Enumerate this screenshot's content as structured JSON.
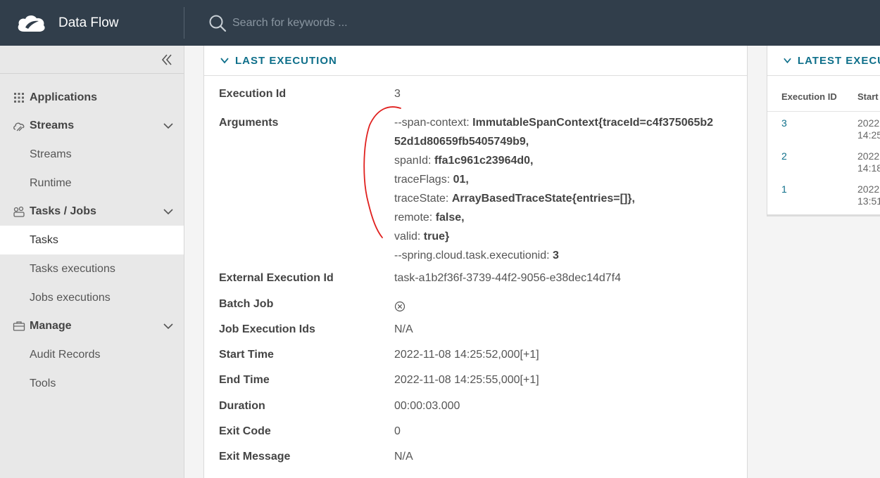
{
  "header": {
    "title": "Data Flow",
    "search_placeholder": "Search for keywords ..."
  },
  "sidebar": {
    "groups": [
      {
        "label": "Applications",
        "icon": "grid-icon"
      },
      {
        "label": "Streams",
        "icon": "streams-icon",
        "items": [
          "Streams",
          "Runtime"
        ]
      },
      {
        "label": "Tasks / Jobs",
        "icon": "tasks-icon",
        "items": [
          "Tasks",
          "Tasks executions",
          "Jobs executions"
        ]
      },
      {
        "label": "Manage",
        "icon": "briefcase-icon",
        "items": [
          "Audit Records",
          "Tools"
        ]
      }
    ],
    "active_item": "Tasks"
  },
  "last_execution": {
    "title": "LAST EXECUTION",
    "execution_id_label": "Execution Id",
    "execution_id": "3",
    "arguments_label": "Arguments",
    "arguments": [
      {
        "key": "--span-context: ",
        "value": "ImmutableSpanContext{traceId=c4f375065b2"
      },
      {
        "key": "",
        "value": "52d1d80659fb5405749b9,"
      },
      {
        "key": "spanId: ",
        "value": "ffa1c961c23964d0,"
      },
      {
        "key": "traceFlags: ",
        "value": "01,"
      },
      {
        "key": "traceState: ",
        "value": "ArrayBasedTraceState{entries=[]},"
      },
      {
        "key": "remote: ",
        "value": "false,"
      },
      {
        "key": "valid: ",
        "value": "true}"
      },
      {
        "key": "--spring.cloud.task.executionid: ",
        "value": "3"
      }
    ],
    "external_execution_id_label": "External Execution Id",
    "external_execution_id": "task-a1b2f36f-3739-44f2-9056-e38dec14d7f4",
    "batch_job_label": "Batch Job",
    "job_execution_ids_label": "Job Execution Ids",
    "job_execution_ids": "N/A",
    "start_time_label": "Start Time",
    "start_time": "2022-11-08 14:25:52,000[+1]",
    "end_time_label": "End Time",
    "end_time": "2022-11-08 14:25:55,000[+1]",
    "duration_label": "Duration",
    "duration": "00:00:03.000",
    "exit_code_label": "Exit Code",
    "exit_code": "0",
    "exit_message_label": "Exit Message",
    "exit_message": "N/A"
  },
  "latest_executions": {
    "title": "LATEST EXECU",
    "col_id": "Execution ID",
    "col_start": "Start",
    "rows": [
      {
        "id": "3",
        "start_1": "2022",
        "start_2": "14:25"
      },
      {
        "id": "2",
        "start_1": "2022",
        "start_2": "14:18"
      },
      {
        "id": "1",
        "start_1": "2022",
        "start_2": "13:51"
      }
    ]
  },
  "colors": {
    "header_bg": "#313e4b",
    "accent": "#0e6f8a",
    "annotation": "#e0201e"
  }
}
